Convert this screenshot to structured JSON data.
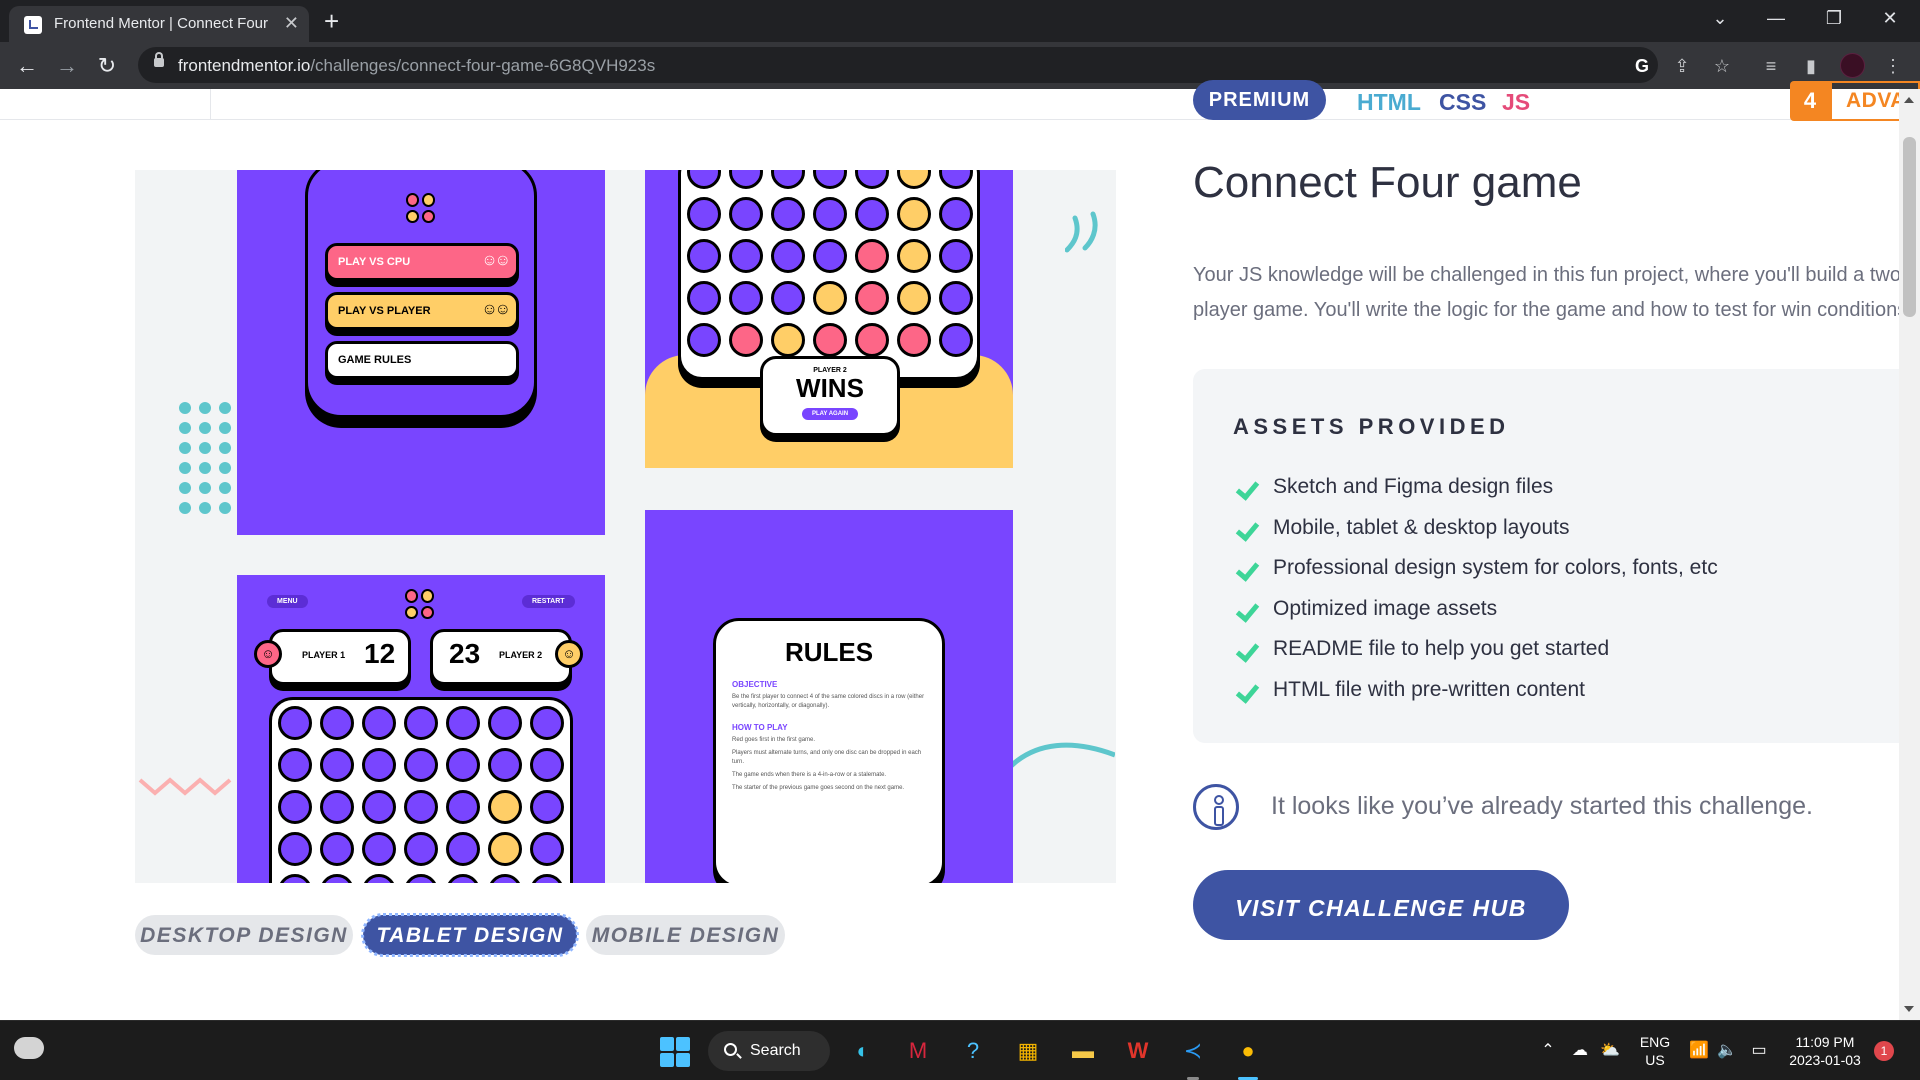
{
  "browser": {
    "tab_title": "Frontend Mentor | Connect Four",
    "tab_close": "✕",
    "new_tab": "+",
    "url_host": "frontendmentor.io",
    "url_path": "/challenges/connect-four-game-6G8QVH923s",
    "icons": [
      "back-icon",
      "forward-icon",
      "reload-icon",
      "lock-icon",
      "google-icon",
      "share-icon",
      "star-icon",
      "reading-list-icon",
      "side-panel-icon",
      "profile-avatar",
      "kebab-menu-icon"
    ]
  },
  "preview": {
    "menu_buttons": [
      "PLAY VS CPU",
      "PLAY VS PLAYER",
      "GAME RULES"
    ],
    "wins_player": "PLAYER 2",
    "wins_label": "WINS",
    "play_again": "PLAY AGAIN",
    "menu_pill": "MENU",
    "restart_pill": "RESTART",
    "player1_label": "PLAYER 1",
    "player1_score": "12",
    "player2_label": "PLAYER 2",
    "player2_score": "23",
    "rules_title": "RULES",
    "rules_objective": "OBJECTIVE",
    "rules_objective_text": "Be the first player to connect 4 of the same colored discs in a row (either vertically, horizontally, or diagonally).",
    "rules_how": "HOW TO PLAY",
    "rules_steps": [
      "Red goes first in the first game.",
      "Players must alternate turns, and only one disc can be dropped in each turn.",
      "The game ends when there is a 4-in-a-row or a stalemate.",
      "The starter of the previous game goes second on the next game."
    ],
    "colors": {
      "purple": "#7945ff",
      "red": "#fd6687",
      "yellow": "#ffce67",
      "dark_purple": "#5c2dd5"
    }
  },
  "design_tabs": [
    {
      "label": "DESKTOP DESIGN",
      "active": false
    },
    {
      "label": "TABLET DESIGN",
      "active": true
    },
    {
      "label": "MOBILE DESIGN",
      "active": false
    }
  ],
  "challenge": {
    "premium_label": "PREMIUM",
    "tags": [
      {
        "label": "HTML",
        "color": "#4aabd1"
      },
      {
        "label": "CSS",
        "color": "#3e54a3"
      },
      {
        "label": "JS",
        "color": "#e54b79"
      }
    ],
    "difficulty_number": "4",
    "difficulty_label": "ADVANCED",
    "title": "Connect Four game",
    "description_line1": "Your JS knowledge will be challenged in this fun project, where you'll build a two-player game.",
    "description_line2": "player game. You'll write the logic for the game and how to test for win conditions.",
    "assets_heading": "ASSETS PROVIDED",
    "assets": [
      "Sketch and Figma design files",
      "Mobile, tablet & desktop layouts",
      "Professional design system for colors, fonts, etc",
      "Optimized image assets",
      "README file to help you get started",
      "HTML file with pre-written content"
    ],
    "notice": "It looks like you’ve already started this challenge.",
    "cta_label": "VISIT CHALLENGE HUB",
    "accent_color": "#3e54a3",
    "check_color": "#3dd598"
  },
  "taskbar": {
    "search_label": "Search",
    "lang_line1": "ENG",
    "lang_line2": "US",
    "time": "11:09 PM",
    "date": "2023-01-03",
    "notification_count": "1"
  }
}
